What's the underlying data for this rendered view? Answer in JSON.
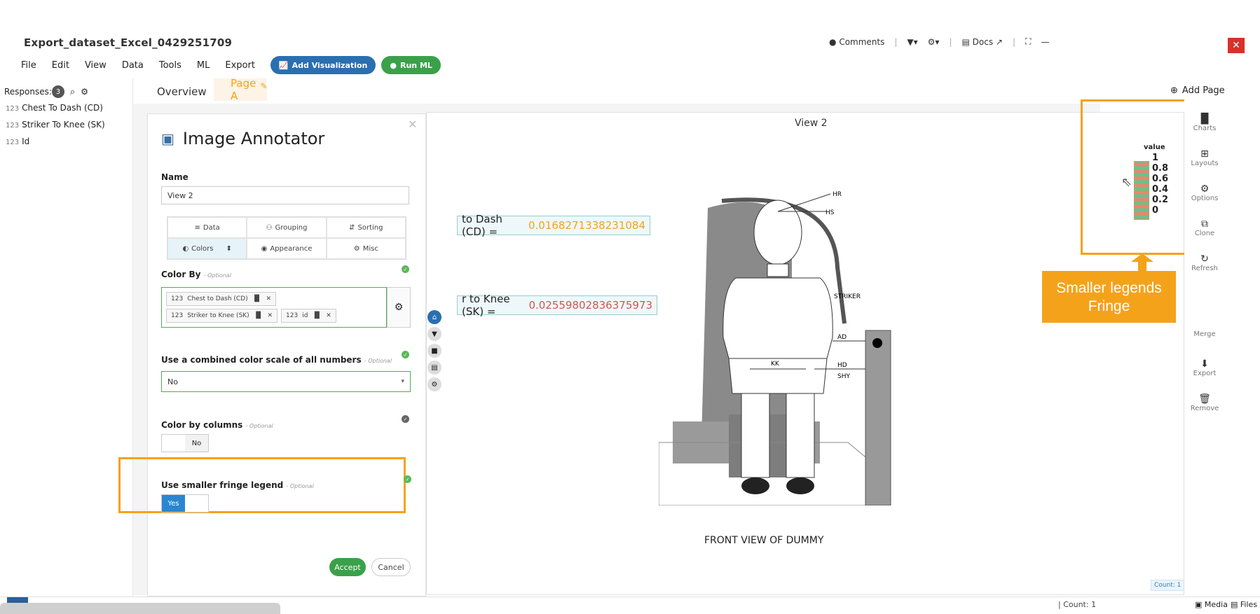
{
  "app": {
    "title": "Export_dataset_Excel_0429251709"
  },
  "menu": [
    "File",
    "Edit",
    "View",
    "Data",
    "Tools",
    "ML",
    "Export"
  ],
  "toolbar": {
    "add_visualization": "Add Visualization",
    "run_ml": "Run ML",
    "add_color": "#2a6fb0",
    "run_color": "#3aa14a"
  },
  "topright": {
    "comments": "Comments",
    "docs": "Docs"
  },
  "left": {
    "responses_label": "Responses:",
    "responses_count": "3",
    "fields": [
      {
        "type": "123",
        "name": "Chest To Dash (CD)"
      },
      {
        "type": "123",
        "name": "Striker To Knee (SK)"
      },
      {
        "type": "123",
        "name": "Id"
      }
    ]
  },
  "tabs": {
    "overview": "Overview",
    "page_a": "Page A",
    "add_page": "Add Page"
  },
  "annotator": {
    "title": "Image Annotator",
    "name_label": "Name",
    "name_value": "View 2",
    "tabs": [
      "Data",
      "Grouping",
      "Sorting",
      "Colors",
      "Appearance",
      "Misc"
    ],
    "color_by_label": "Color By",
    "optional": "- Optional",
    "chips": [
      {
        "type": "123",
        "label": "Chest to Dash (CD)"
      },
      {
        "type": "123",
        "label": "Striker to Knee (SK)"
      },
      {
        "type": "123",
        "label": "id"
      }
    ],
    "combined_label": "Use a combined color scale of all numbers",
    "combined_value": "No",
    "color_cols_label": "Color by columns",
    "color_cols_value": "No",
    "fringe_label": "Use smaller fringe legend",
    "fringe_value": "Yes",
    "accept": "Accept",
    "cancel": "Cancel"
  },
  "view": {
    "title": "View 2",
    "values": [
      {
        "label": "to Dash (CD) = ",
        "value": "0.0168271338231084",
        "color": "#f5a21b"
      },
      {
        "label": "r to Knee (SK) = ",
        "value": "0.02559802836375973",
        "color": "#d9534f"
      }
    ],
    "figure_labels": {
      "hr": "HR",
      "hs": "HS",
      "striker": "STRIKER",
      "ad": "AD",
      "kk": "KK",
      "hd": "HD",
      "shy": "SHY"
    },
    "caption": "FRONT VIEW OF DUMMY",
    "count": "Count: 1"
  },
  "legend": {
    "title": "value",
    "ticks": [
      "1",
      "0.8",
      "0.6",
      "0.4",
      "0.2",
      "0"
    ]
  },
  "rightbar": [
    "Charts",
    "Layouts",
    "Options",
    "Clone",
    "Refresh",
    "Merge",
    "Export",
    "Remove"
  ],
  "callout": {
    "line1": "Smaller legends",
    "line2": "Fringe"
  },
  "footer": {
    "count": "Count: 1",
    "media": "Media",
    "files": "Files"
  }
}
